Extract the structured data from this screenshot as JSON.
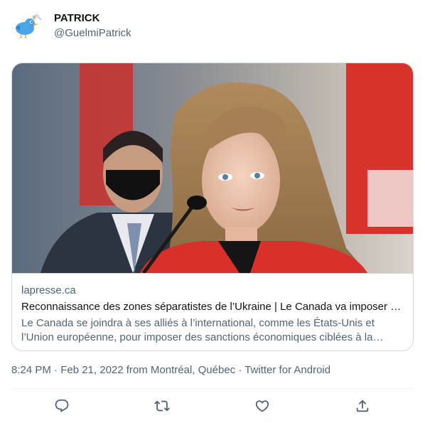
{
  "author": {
    "name": "PATRICK",
    "handle": "@GuelmiPatrick",
    "avatar_icon": "bird-megaphone-icon"
  },
  "card": {
    "domain": "lapresse.ca",
    "title": "Reconnaissance des zones séparatistes de l’Ukraine | Le Canada va imposer des sanctions",
    "description": "Le Canada se joindra à ses alliés à l’international, comme les États-Unis et l’Union européenne, pour imposer des sanctions économiques ciblées à la Russie",
    "image_alt": "Woman in red jacket speaking at microphone, man in mask behind her, Canadian flags"
  },
  "meta": {
    "text": "8:24 PM · Feb 21, 2022 from Montréal, Québec · Twitter for Android"
  },
  "actions": [
    {
      "name": "reply",
      "icon": "reply-icon"
    },
    {
      "name": "retweet",
      "icon": "retweet-icon"
    },
    {
      "name": "like",
      "icon": "heart-icon"
    },
    {
      "name": "share",
      "icon": "share-icon"
    }
  ],
  "colors": {
    "text_primary": "#0f1419",
    "text_secondary": "#536471",
    "border": "#cfd9de",
    "bird_blue": "#4aa4e6"
  }
}
